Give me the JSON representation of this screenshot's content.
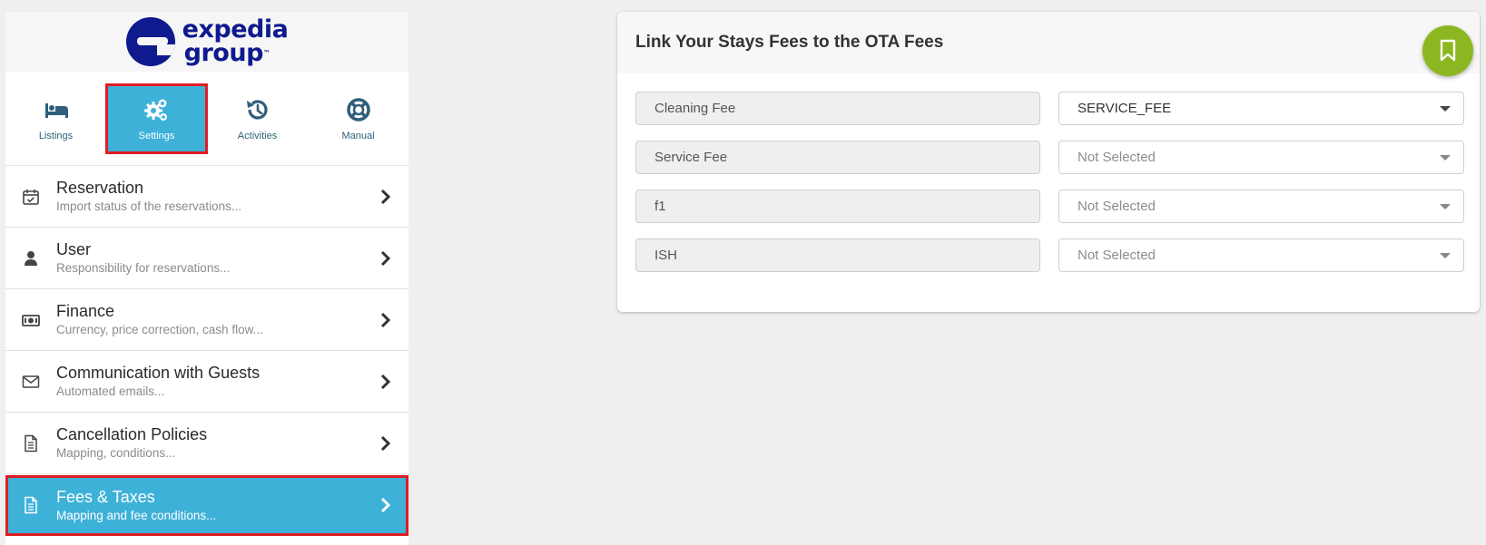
{
  "brand": {
    "line1": "expedia",
    "line2": "group",
    "tm": "™"
  },
  "topnav": [
    {
      "label": "Listings",
      "icon": "bed-icon",
      "active": false
    },
    {
      "label": "Settings",
      "icon": "gears-icon",
      "active": true
    },
    {
      "label": "Activities",
      "icon": "history-icon",
      "active": false
    },
    {
      "label": "Manual",
      "icon": "lifebuoy-icon",
      "active": false
    }
  ],
  "menu": [
    {
      "title": "Reservation",
      "subtitle": "Import status of the reservations...",
      "icon": "calendar-check-icon"
    },
    {
      "title": "User",
      "subtitle": "Responsibility for reservations...",
      "icon": "user-icon"
    },
    {
      "title": "Finance",
      "subtitle": "Currency, price correction, cash flow...",
      "icon": "money-icon"
    },
    {
      "title": "Communication with Guests",
      "subtitle": "Automated emails...",
      "icon": "envelope-icon"
    },
    {
      "title": "Cancellation Policies",
      "subtitle": "Mapping, conditions...",
      "icon": "document-icon"
    },
    {
      "title": "Fees & Taxes",
      "subtitle": "Mapping and fee conditions...",
      "icon": "document-icon",
      "active": true
    }
  ],
  "card": {
    "title": "Link Your Stays Fees to the OTA Fees",
    "rows": [
      {
        "fee": "Cleaning Fee",
        "selected": "SERVICE_FEE",
        "is_placeholder": false
      },
      {
        "fee": "Service Fee",
        "selected": "Not Selected",
        "is_placeholder": true
      },
      {
        "fee": "f1",
        "selected": "Not Selected",
        "is_placeholder": true
      },
      {
        "fee": "ISH",
        "selected": "Not Selected",
        "is_placeholder": true
      }
    ]
  },
  "colors": {
    "accent": "#3eb1d9",
    "highlight": "#e01c24",
    "save": "#8db720",
    "brand": "#0e1a8e"
  }
}
